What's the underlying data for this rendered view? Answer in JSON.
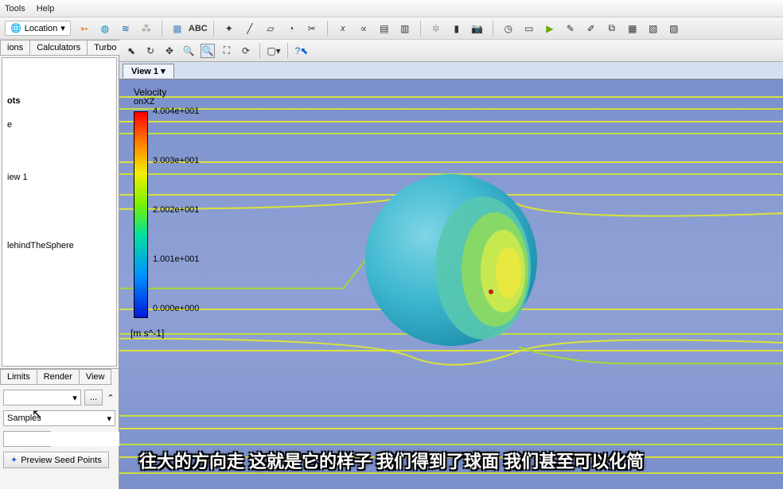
{
  "menu": {
    "tools": "Tools",
    "help": "Help"
  },
  "toolbar": {
    "location": "Location"
  },
  "side_tabs": {
    "t1": "ions",
    "t2": "Calculators",
    "t3": "Turbo"
  },
  "tree": {
    "n1": "ots",
    "n2": "e",
    "n3": "iew 1",
    "n4": "lehindTheSphere"
  },
  "props_tabs": {
    "t1": "Limits",
    "t2": "Render",
    "t3": "View"
  },
  "props": {
    "samples": "Samples",
    "preview": "Preview Seed Points",
    "ellipsis": "...",
    "updown": "▲"
  },
  "viewtab": {
    "name": "View 1"
  },
  "legend": {
    "title": "Velocity",
    "sub": "onXZ",
    "t0": "4.004e+001",
    "t1": "3.003e+001",
    "t2": "2.002e+001",
    "t3": "1.001e+001",
    "t4": "0.000e+000",
    "units": "[m s^-1]"
  },
  "subtitle": "往大的方向走 这就是它的样子 我们得到了球面 我们甚至可以化简"
}
